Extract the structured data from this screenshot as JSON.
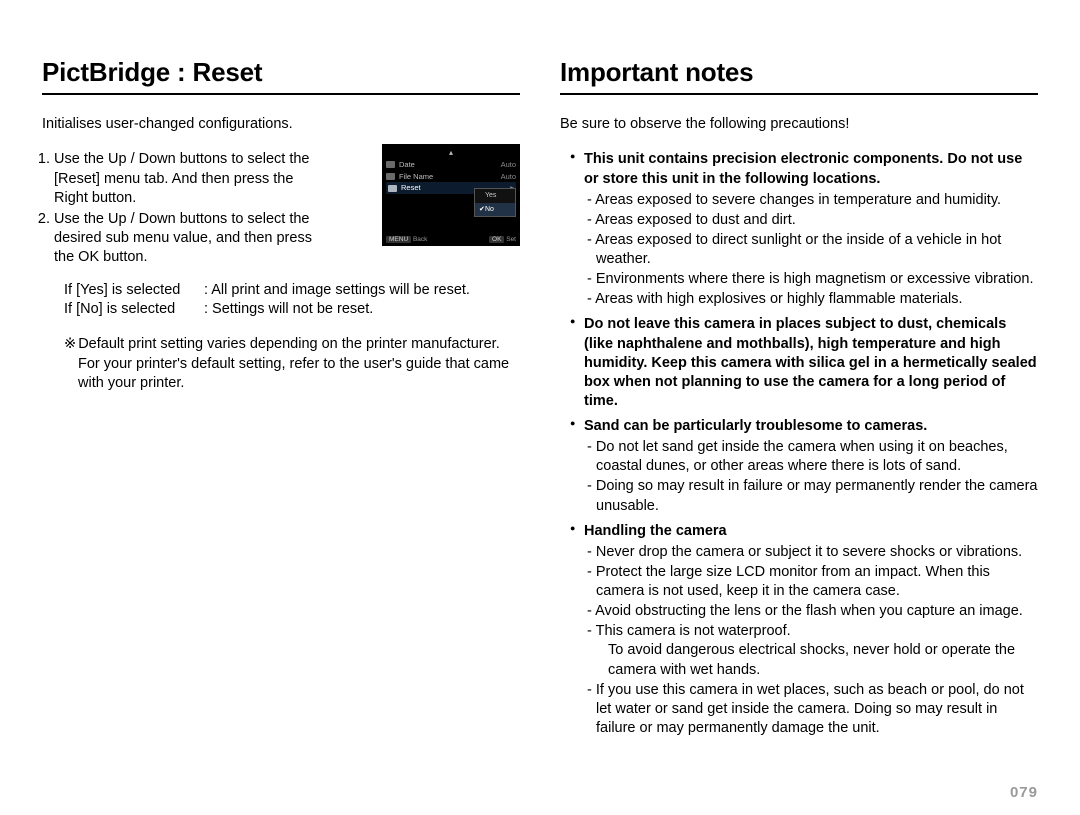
{
  "left": {
    "title": "PictBridge : Reset",
    "intro": "Initialises user-changed configurations.",
    "steps": [
      "Use the Up / Down buttons to select the [Reset] menu tab. And then press the Right button.",
      "Use the Up / Down buttons to select the desired sub menu value, and then press the OK button."
    ],
    "if_rows": [
      {
        "cond": "If [Yes] is selected",
        "result": ": All print and image settings will be reset."
      },
      {
        "cond": "If [No] is selected",
        "result": ": Settings will not be reset."
      }
    ],
    "default_note_marker": "※",
    "default_note": "Default print setting varies depending on the printer manufacturer. For your printer's default setting, refer to the user's guide that came with your printer."
  },
  "lcd": {
    "rows": [
      {
        "label": "Date",
        "value": "Auto"
      },
      {
        "label": "File Name",
        "value": "Auto"
      }
    ],
    "reset_label": "Reset",
    "options": {
      "yes": "Yes",
      "no": "No"
    },
    "footer": {
      "back_btn": "MENU",
      "back": "Back",
      "set_btn": "OK",
      "set": "Set"
    }
  },
  "right": {
    "title": "Important notes",
    "intro": "Be sure to observe the following precautions!",
    "sections": [
      {
        "lead_bold": "This unit contains precision electronic components. Do not use or store this unit in the following locations.",
        "items": [
          "Areas exposed to severe changes in temperature and humidity.",
          "Areas exposed to dust and dirt.",
          "Areas exposed to direct sunlight or the inside of a vehicle in hot weather.",
          "Environments where there is high magnetism or excessive vibration.",
          "Areas with high explosives or highly flammable materials."
        ]
      },
      {
        "lead_bold": "Do not leave this camera in places subject to dust, chemicals (like naphthalene and mothballs), high temperature and high humidity. Keep this camera with silica gel in a hermetically sealed box when not planning to use the camera for a long period of time.",
        "items": []
      },
      {
        "lead_bold": "Sand can be particularly troublesome to cameras.",
        "items": [
          "Do not let sand get inside the camera when using it on beaches, coastal dunes, or other areas where there is lots of sand.",
          "Doing so may result in failure or may permanently render the camera unusable."
        ]
      },
      {
        "lead_bold": "Handling the camera",
        "items": [
          "Never drop the camera or subject it to severe shocks or vibrations.",
          "Protect  the large size LCD monitor from an impact. When this camera is not used, keep it in the camera case.",
          "Avoid obstructing the lens or the flash when you capture an image.",
          "This camera is not waterproof.\nTo avoid dangerous electrical shocks, never hold or operate the camera with wet hands.",
          "If you use this camera in wet places, such as beach or pool, do not let water or sand get inside the camera. Doing so may result in failure or may permanently damage the unit."
        ]
      }
    ]
  },
  "page_number": "079"
}
